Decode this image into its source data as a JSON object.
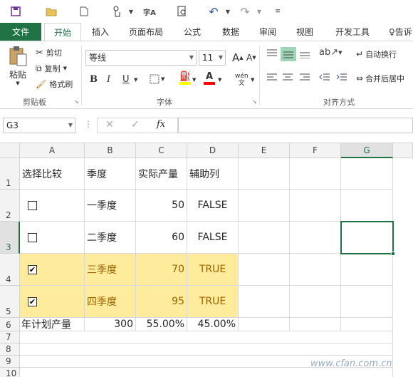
{
  "qat": {
    "save": "save-icon",
    "open": "folder-icon",
    "new": "new-doc-icon",
    "touch": "touch-icon",
    "spell": "字A",
    "preview": "preview-icon",
    "undo": "↶",
    "redo": "↷"
  },
  "tabs": [
    "文件",
    "开始",
    "插入",
    "页面布局",
    "公式",
    "数据",
    "审阅",
    "视图",
    "开发工具",
    "告诉"
  ],
  "clipboard": {
    "paste": "粘贴",
    "cut": "剪切",
    "copy": "复制",
    "format_painter": "格式刷",
    "label": "剪贴板"
  },
  "font": {
    "name": "等线",
    "size": "11",
    "bold": "B",
    "italic": "I",
    "underline": "U",
    "grow": "A",
    "shrink": "A",
    "phonetic": "wén",
    "label": "字体",
    "fill_color": "#ffff00",
    "font_color": "#ff0000"
  },
  "alignment": {
    "wrap": "自动换行",
    "merge": "合并后居中",
    "label": "对齐方式"
  },
  "formula_bar": {
    "name_box": "G3",
    "fx": "fx",
    "value": ""
  },
  "columns": [
    "A",
    "B",
    "C",
    "D",
    "E",
    "F",
    "G"
  ],
  "rows": [
    "1",
    "2",
    "3",
    "4",
    "5",
    "6",
    "7",
    "8",
    "9",
    "10"
  ],
  "cells": {
    "r1": {
      "a": "选择比较",
      "b": "季度",
      "c": "实际产量",
      "d": "辅助列"
    },
    "r2": {
      "a_checked": false,
      "b": "一季度",
      "c": "50",
      "d": "FALSE"
    },
    "r3": {
      "a_checked": false,
      "b": "二季度",
      "c": "60",
      "d": "FALSE"
    },
    "r4": {
      "a_checked": true,
      "b": "三季度",
      "c": "70",
      "d": "TRUE"
    },
    "r5": {
      "a_checked": true,
      "b": "四季度",
      "c": "95",
      "d": "TRUE"
    },
    "r6": {
      "a": "年计划产量",
      "b": "300",
      "c": "55.00%",
      "d": "45.00%"
    }
  },
  "active_cell": "G3",
  "watermark": "www.cfan.com.cn",
  "colors": {
    "accent": "#217346",
    "highlight_fill": "#ffeb9c",
    "highlight_text": "#9c6500"
  }
}
